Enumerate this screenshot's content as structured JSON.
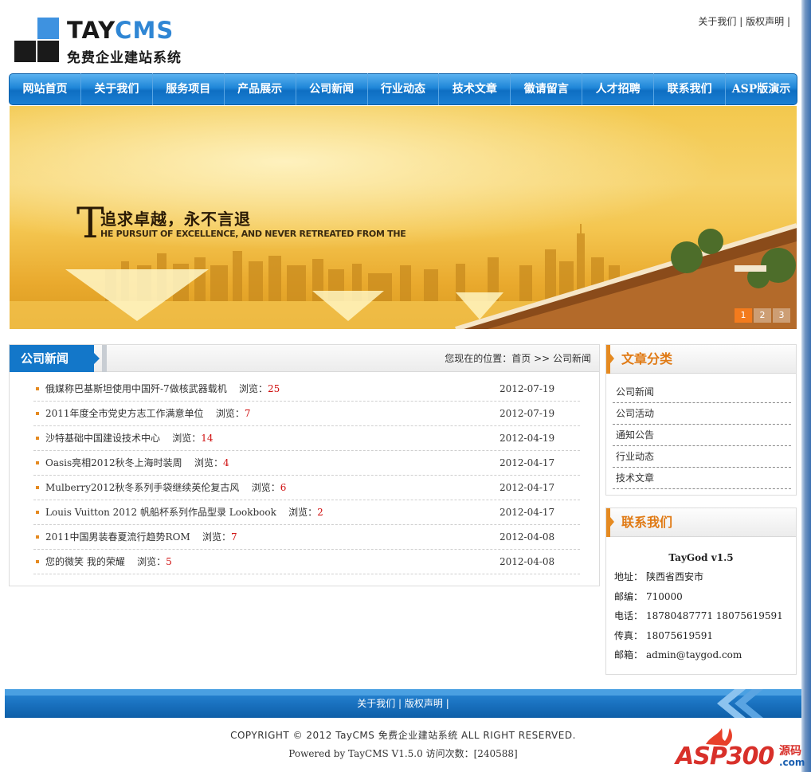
{
  "header": {
    "logo_tay": "TAY",
    "logo_cms": "CMS",
    "logo_sub": "免费企业建站系统",
    "top_links": [
      "关于我们",
      "版权声明"
    ],
    "top_sep": "|"
  },
  "nav": {
    "items": [
      "网站首页",
      "关于我们",
      "服务项目",
      "产品展示",
      "公司新闻",
      "行业动态",
      "技术文章",
      "徽请留言",
      "人才招聘",
      "联系我们",
      "ASP版演示"
    ]
  },
  "banner": {
    "big_letter": "T",
    "slogan": "追求卓越，永不言退",
    "slogan_en": "HE PURSUIT OF EXCELLENCE, AND NEVER RETREATED FROM THE",
    "slides": [
      "1",
      "2",
      "3"
    ],
    "active_slide": 0
  },
  "main": {
    "title": "公司新闻",
    "breadcrumb": "您现在的位置：首页  >> 公司新闻",
    "views_label": "浏览：",
    "news": [
      {
        "title": "俄媒称巴基斯坦使用中国歼-7做核武器载机",
        "views": "25",
        "date": "2012-07-19"
      },
      {
        "title": "2011年度全市党史方志工作满意单位",
        "views": "7",
        "date": "2012-07-19"
      },
      {
        "title": "沙特基础中国建设技术中心",
        "views": "14",
        "date": "2012-04-19"
      },
      {
        "title": "Oasis亮相2012秋冬上海时装周",
        "views": "4",
        "date": "2012-04-17"
      },
      {
        "title": "Mulberry2012秋冬系列手袋继续英伦复古风",
        "views": "6",
        "date": "2012-04-17"
      },
      {
        "title": "Louis Vuitton 2012 帆船杯系列作品型录 Lookbook",
        "views": "2",
        "date": "2012-04-17"
      },
      {
        "title": "2011中国男装春夏流行趋势ROM",
        "views": "7",
        "date": "2012-04-08"
      },
      {
        "title": "您的微笑 我的荣耀",
        "views": "5",
        "date": "2012-04-08"
      }
    ]
  },
  "sidebar": {
    "categories_title": "文章分类",
    "categories": [
      "公司新闻",
      "公司活动",
      "通知公告",
      "行业动态",
      "技术文章"
    ],
    "contact_title": "联系我们",
    "contact_name": "TayGod v1.5",
    "contact": [
      {
        "label": "地址：",
        "value": "陕西省西安市"
      },
      {
        "label": "邮编：",
        "value": "710000"
      },
      {
        "label": "电话：",
        "value": "18780487771 18075619591"
      },
      {
        "label": "传真：",
        "value": "18075619591"
      },
      {
        "label": "邮箱：",
        "value": "admin@taygod.com"
      }
    ]
  },
  "footer": {
    "links": [
      "关于我们",
      "版权声明"
    ],
    "sep": "|",
    "copyright": "COPYRIGHT © 2012 TayCMS 免费企业建站系统 ALL RIGHT RESERVED.",
    "powered": "Powered by TayCMS V1.5.0 访问次数：[240588]"
  },
  "watermark": {
    "text": "ASP300",
    "suffix_top": "源码",
    "suffix_bottom": ".com"
  },
  "colors": {
    "nav_blue": "#1377c9",
    "accent_orange": "#e07a14",
    "views_red": "#d01010"
  }
}
